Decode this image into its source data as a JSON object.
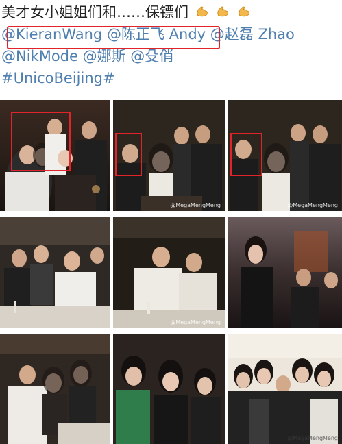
{
  "post": {
    "caption": "美才女小姐姐们和……保镖们",
    "line2": {
      "mention_1": "@KieranWang",
      "mention_2": "@陈正飞 Andy",
      "mention_3": "@赵磊 Zhao"
    },
    "line3": {
      "mention_1": "@NikMode",
      "mention_2": "@娜斯",
      "mention_3": "@殳俏"
    },
    "hashtag": "#UnicoBeijing#",
    "emoji_icon": "flexed-biceps-icon",
    "colors": {
      "text": "#222222",
      "link": "#4f7fae",
      "highlight": "#e0242a"
    }
  },
  "photos": [
    {
      "id": "photo-1",
      "watermark": ""
    },
    {
      "id": "photo-2",
      "watermark": "@MegaMengMeng"
    },
    {
      "id": "photo-3",
      "watermark": "@MegaMengMeng"
    },
    {
      "id": "photo-4",
      "watermark": ""
    },
    {
      "id": "photo-5",
      "watermark": "@MegaMengMeng"
    },
    {
      "id": "photo-6",
      "watermark": ""
    },
    {
      "id": "photo-7",
      "watermark": ""
    },
    {
      "id": "photo-8",
      "watermark": ""
    },
    {
      "id": "photo-9",
      "watermark": "@MegaMengMeng"
    }
  ]
}
